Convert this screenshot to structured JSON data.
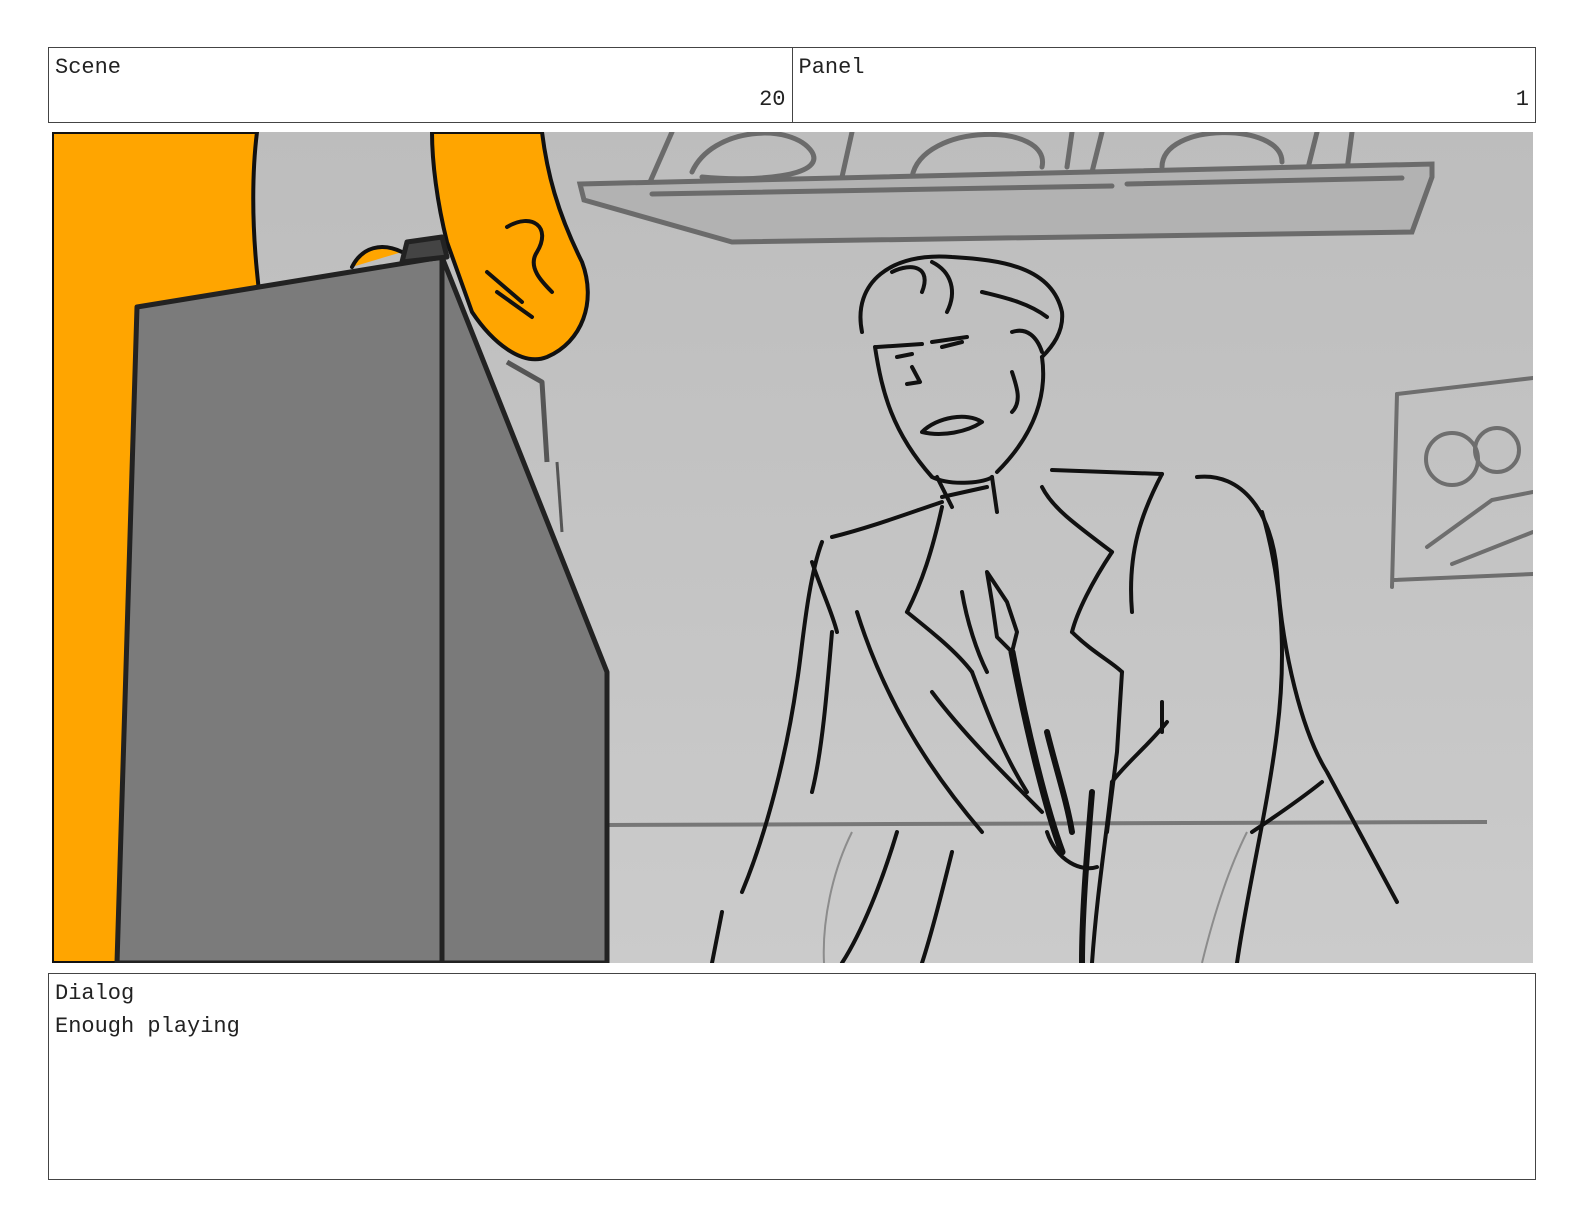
{
  "header": {
    "scene_label": "Scene",
    "scene_value": "20",
    "panel_label": "Panel",
    "panel_value": "1"
  },
  "panel_image": {
    "description_icon": "storyboard-sketch",
    "colors": {
      "background": "#c4c4c4",
      "foreground_figure": "#ffa500",
      "podium": "#7b7b7b",
      "linework": "#111111"
    }
  },
  "dialog": {
    "label": "Dialog",
    "text": "Enough playing"
  }
}
